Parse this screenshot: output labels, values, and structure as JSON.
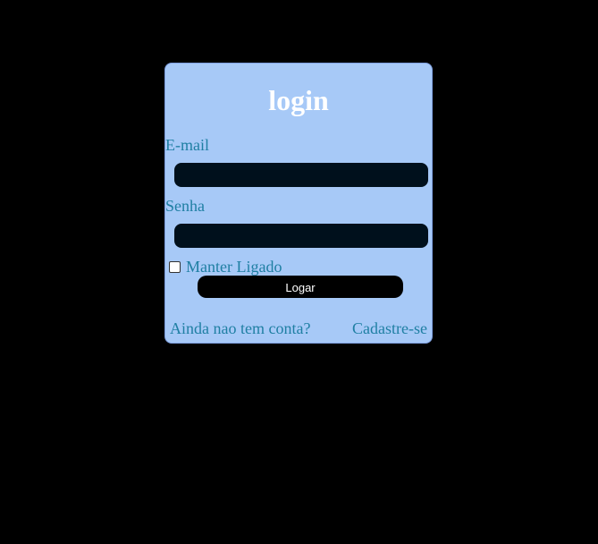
{
  "login": {
    "title": "login",
    "email_label": "E-mail",
    "email_value": "",
    "senha_label": "Senha",
    "senha_value": "",
    "remember_label": "Manter Ligado",
    "remember_checked": false,
    "submit_label": "Logar",
    "no_account_text": "Ainda nao tem conta?",
    "signup_link": "Cadastre-se"
  },
  "colors": {
    "page_background": "#000000",
    "card_background": "#a7c9f7",
    "label_color": "#1f7fa3",
    "input_background": "#00101c",
    "button_background": "#000000"
  }
}
